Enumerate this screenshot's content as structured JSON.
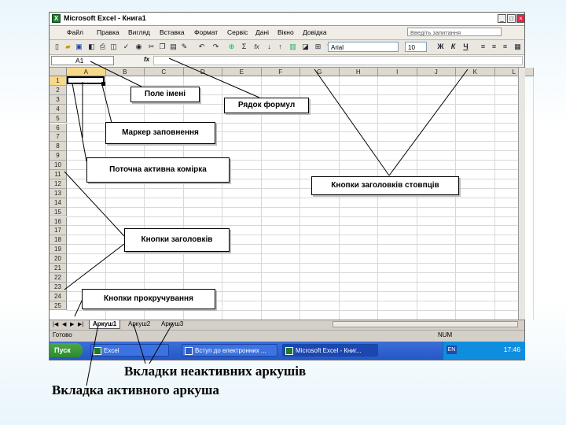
{
  "window": {
    "title": "Microsoft Excel - Книга1",
    "min": "_",
    "max": "□",
    "close": "×"
  },
  "menu": {
    "items": [
      "Файл",
      "Правка",
      "Вигляд",
      "Вставка",
      "Формат",
      "Сервіс",
      "Дані",
      "Вікно",
      "Довідка"
    ],
    "help_placeholder": "Введіть запитання"
  },
  "toolbar": {
    "font": "Arial",
    "size": "10",
    "bold": "Ж",
    "italic": "К",
    "underline": "Ч",
    "sum": "Σ",
    "fx": "fx"
  },
  "formula_bar": {
    "name_box": "A1",
    "fx": "fx"
  },
  "columns": [
    "A",
    "B",
    "C",
    "D",
    "E",
    "F",
    "G",
    "H",
    "I",
    "J",
    "K",
    "L"
  ],
  "rows": [
    "1",
    "2",
    "3",
    "4",
    "5",
    "6",
    "7",
    "8",
    "9",
    "10",
    "11",
    "12",
    "13",
    "14",
    "15",
    "16",
    "17",
    "18",
    "19",
    "20",
    "21",
    "22",
    "23",
    "24",
    "25"
  ],
  "sheet_tabs": [
    "Аркуш1",
    "Аркуш2",
    "Аркуш3"
  ],
  "status": {
    "ready": "Готово",
    "num": "NUM"
  },
  "taskbar": {
    "start": "Пуск",
    "tasks": [
      "Excel",
      "Вступ до електронних ...",
      "Microsoft Excel - Книг..."
    ],
    "lang": "EN",
    "clock": "17:46"
  },
  "callouts": {
    "name_field": "Поле імені",
    "formula_row": "Рядок формул",
    "fill_handle": "Маркер заповнення",
    "active_cell": "Поточна активна комірка",
    "column_headers": "Кнопки заголовків стовпців",
    "row_headers": "Кнопки заголовків",
    "scroll_buttons": "Кнопки прокручування",
    "inactive_tabs": "Вкладки неактивних аркушів",
    "active_tab": "Вкладка активного аркуша"
  }
}
